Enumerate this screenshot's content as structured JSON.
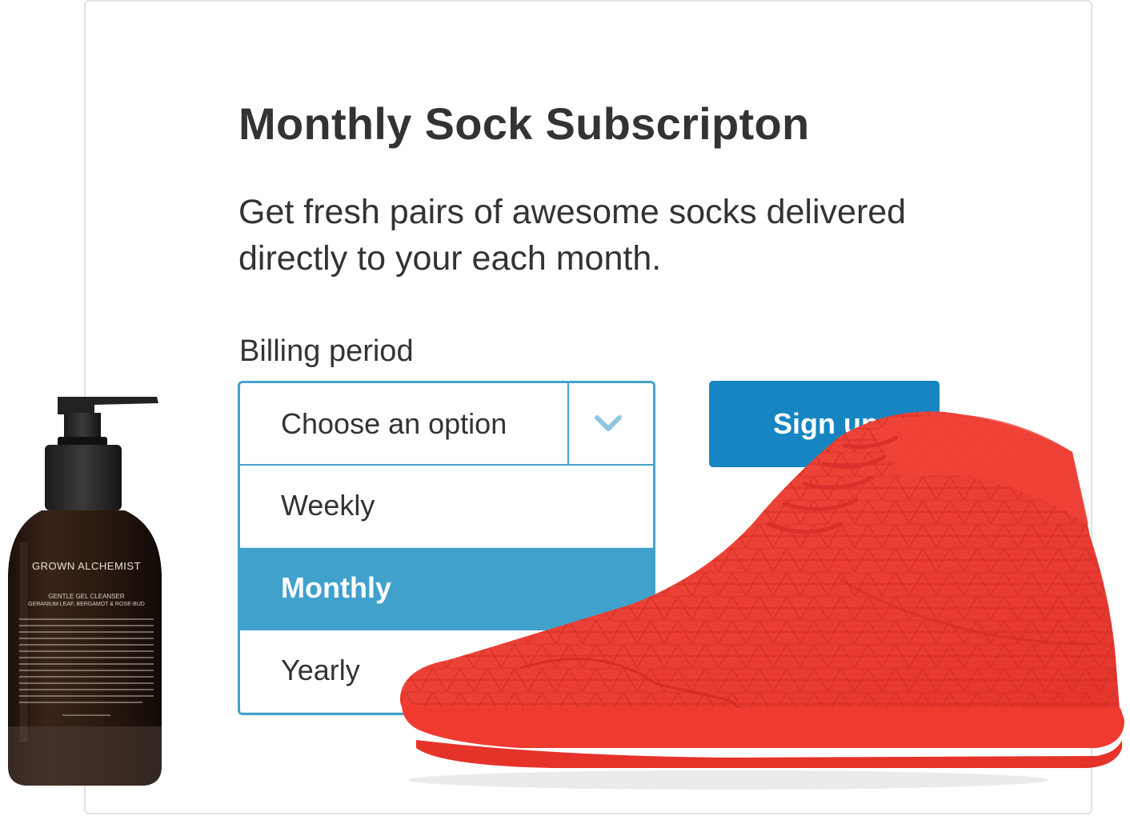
{
  "card": {
    "title": "Monthly Sock Subscripton",
    "description": "Get fresh pairs of awesome socks delivered directly to your each month."
  },
  "billing": {
    "label": "Billing period",
    "placeholder": "Choose an option",
    "options": [
      "Weekly",
      "Monthly",
      "Yearly"
    ],
    "highlighted": "Monthly"
  },
  "signup": {
    "label": "Sign up"
  },
  "bottle": {
    "brand": "GROWN ALCHEMIST",
    "product": "GENTLE GEL CLEANSER",
    "ingredients": "GERANIUM LEAF, BERGAMOT & ROSE-BUD"
  },
  "colors": {
    "accent": "#46a2cc",
    "selected_option": "#41a1cd",
    "button": "#1685c2",
    "shoe": "#ef3b2f",
    "text": "#333333"
  },
  "icons": {
    "dropdown": "chevron-down-icon"
  }
}
